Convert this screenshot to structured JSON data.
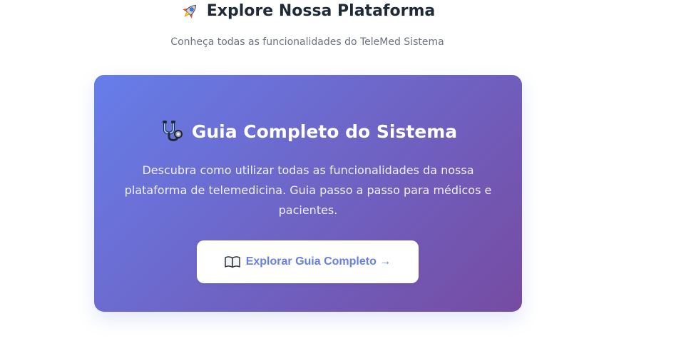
{
  "section": {
    "title": "Explore Nossa Plataforma",
    "subtitle": "Conheça todas as funcionalidades do TeleMed Sistema"
  },
  "guide_card": {
    "title": "Guia Completo do Sistema",
    "description": "Descubra como utilizar todas as funcionalidades da nossa plataforma de telemedicina. Guia passo a passo para médicos e pacientes.",
    "button_label": "Explorar Guia Completo →"
  },
  "icons": {
    "title_icon": "rocket-icon",
    "card_icon": "stethoscope-icon",
    "button_icon": "open-book-icon"
  },
  "colors": {
    "gradient_start": "#667eea",
    "gradient_end": "#764ba2",
    "button_text": "#667eea",
    "title_text": "#1f2937",
    "subtitle_text": "#6b7280"
  }
}
